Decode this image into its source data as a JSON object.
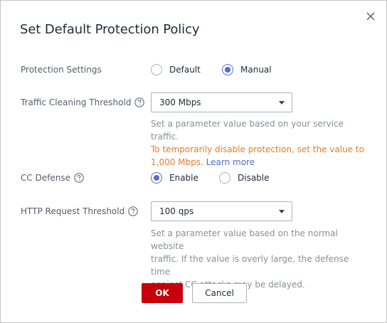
{
  "dialog": {
    "title": "Set Default Protection Policy",
    "close_icon": "close-icon"
  },
  "protection_settings": {
    "label": "Protection Settings",
    "options": [
      {
        "label": "Default",
        "checked": false
      },
      {
        "label": "Manual",
        "checked": true
      }
    ]
  },
  "traffic_threshold": {
    "label": "Traffic Cleaning Threshold",
    "help_icon": "question-circle-icon",
    "value": "300 Mbps",
    "hint_line1": "Set a parameter value based on your service traffic.",
    "hint_warn_line1": "To temporarily disable protection, set the value to",
    "hint_warn_line2": "1,000 Mbps.",
    "learn_more": "Learn more"
  },
  "cc_defense": {
    "label": "CC Defense",
    "help_icon": "question-circle-icon",
    "options": [
      {
        "label": "Enable",
        "checked": true
      },
      {
        "label": "Disable",
        "checked": false
      }
    ]
  },
  "http_threshold": {
    "label": "HTTP Request Threshold",
    "help_icon": "question-circle-icon",
    "value": "100 qps",
    "hint_line1": "Set a parameter value based on the normal website",
    "hint_line2": "traffic. If the value is overly large, the defense time",
    "hint_line3": "against CC attacks may be delayed."
  },
  "footer": {
    "ok_label": "OK",
    "cancel_label": "Cancel"
  },
  "colors": {
    "primary": "#526ecc",
    "ok_button": "#c7000b",
    "warning_text": "#e37d29",
    "hint_text": "#8a8e99"
  }
}
